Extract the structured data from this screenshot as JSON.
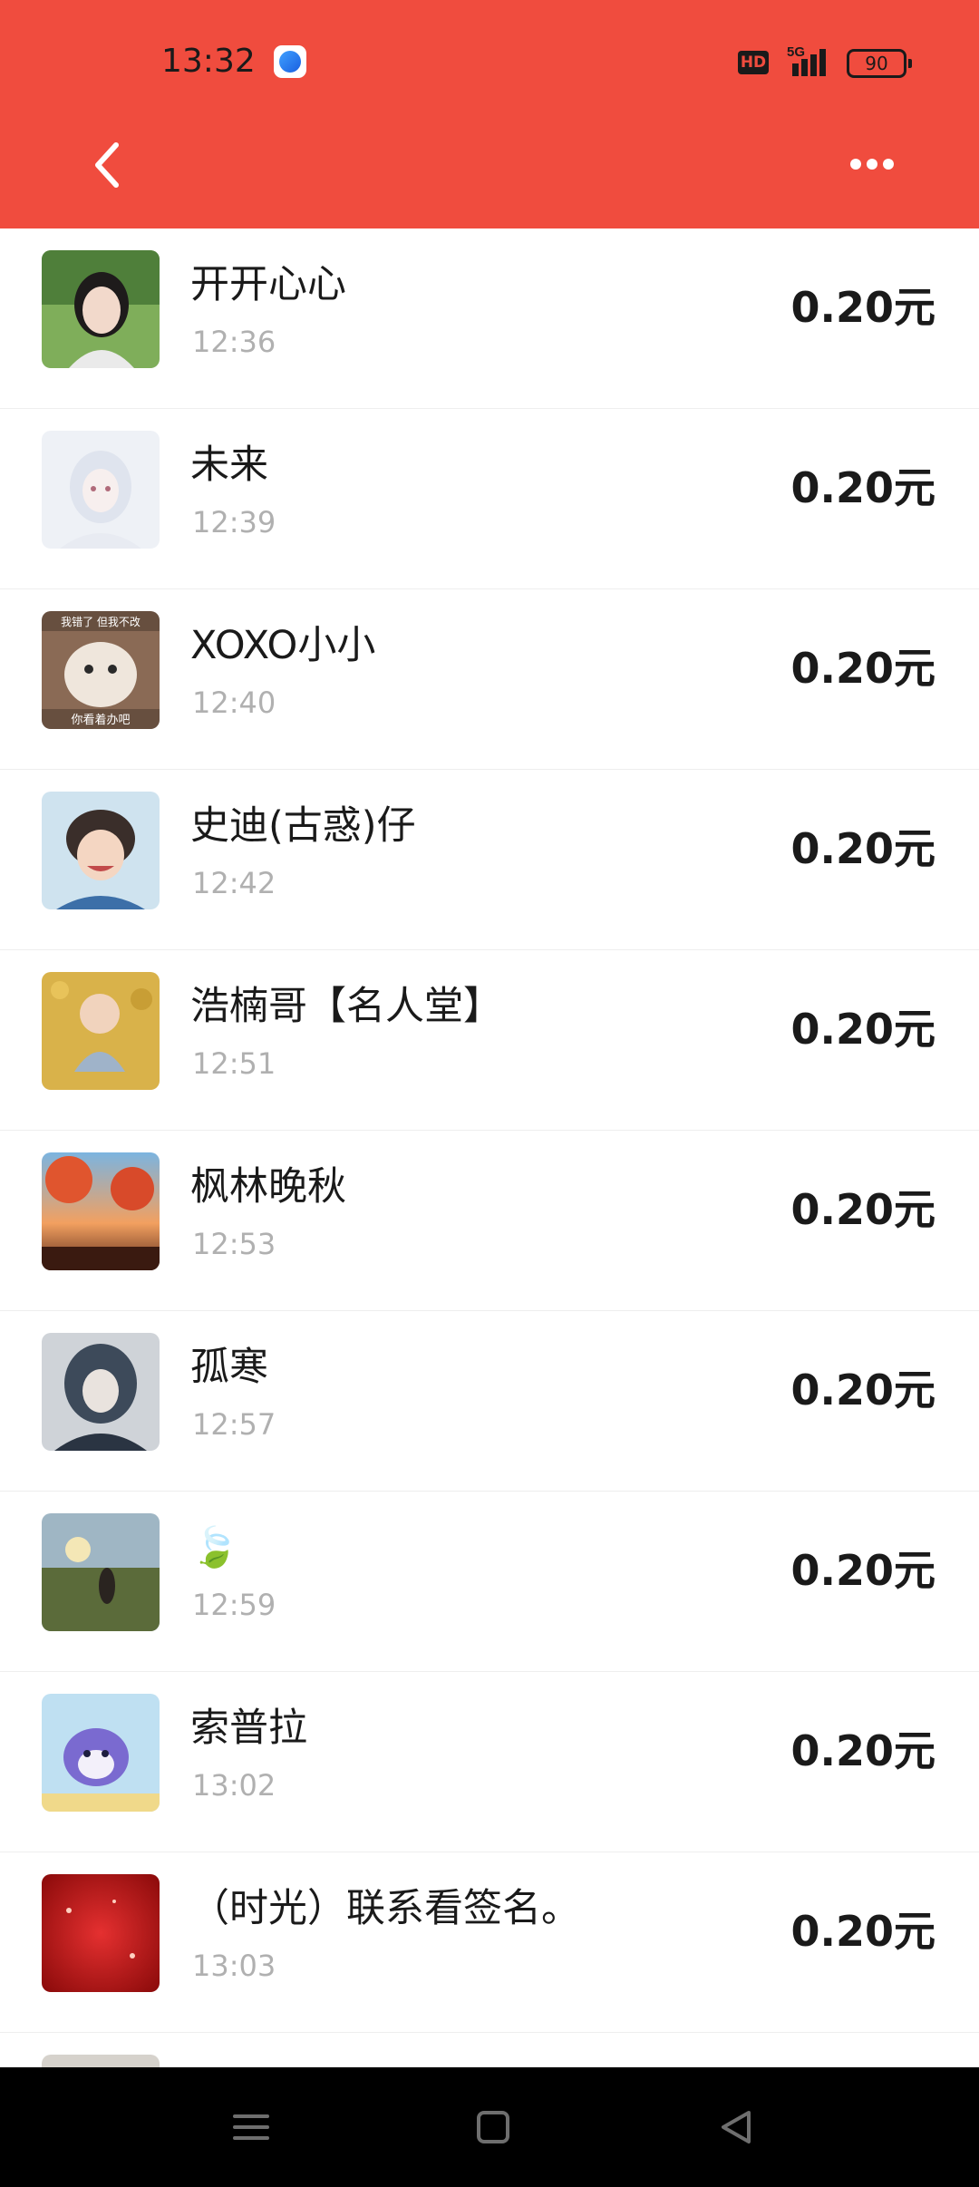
{
  "status_bar": {
    "time": "13:32",
    "hd_label": "HD",
    "network_label": "5G",
    "battery": "90"
  },
  "header": {
    "background_color": "#f04c3e",
    "back_icon": "chevron-left-icon",
    "more_icon": "more-horizontal-icon"
  },
  "records": [
    {
      "name": "开开心心",
      "time": "12:36",
      "amount": "0.20元"
    },
    {
      "name": "未来",
      "time": "12:39",
      "amount": "0.20元"
    },
    {
      "name": "XOXO小小",
      "time": "12:40",
      "amount": "0.20元",
      "avatar_caption_top": "我错了 但我不改",
      "avatar_caption_bottom": "你看着办吧"
    },
    {
      "name": "史迪(古惑)仔",
      "time": "12:42",
      "amount": "0.20元"
    },
    {
      "name": "浩楠哥【名人堂】",
      "time": "12:51",
      "amount": "0.20元"
    },
    {
      "name": "枫林晚秋",
      "time": "12:53",
      "amount": "0.20元"
    },
    {
      "name": "孤寒",
      "time": "12:57",
      "amount": "0.20元"
    },
    {
      "name": "🍃",
      "time": "12:59",
      "amount": "0.20元"
    },
    {
      "name": "索普拉",
      "time": "13:02",
      "amount": "0.20元"
    },
    {
      "name": "（时光）联系看签名。",
      "time": "13:03",
      "amount": "0.20元"
    }
  ],
  "nav_bar": {
    "menu_icon": "menu-icon",
    "home_icon": "home-square-icon",
    "back_icon": "back-triangle-icon"
  }
}
